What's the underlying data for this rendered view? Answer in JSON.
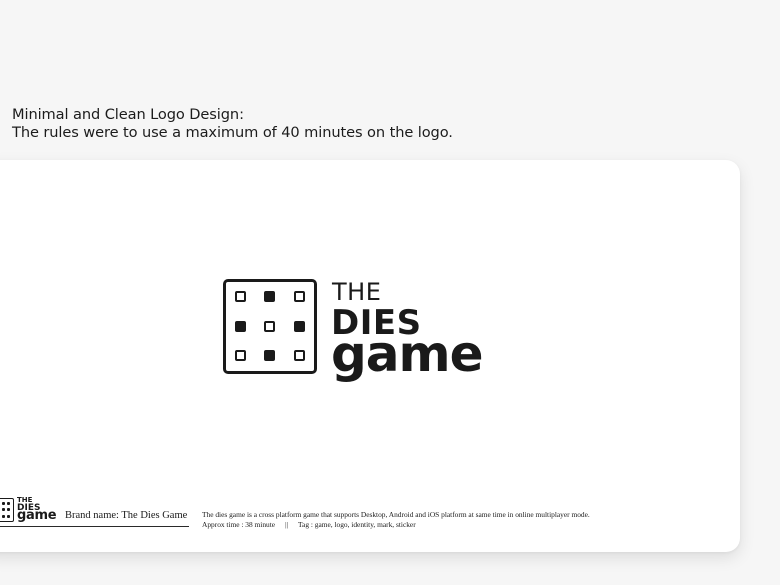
{
  "intro": {
    "line1": "Minimal and Clean Logo Design:",
    "line2": "The rules were to use a maximum of 40 minutes on the logo."
  },
  "logo": {
    "the": "THE",
    "dies": "DIES",
    "game": "game",
    "pips": [
      "hollow",
      "filled",
      "hollow",
      "filled",
      "hollow",
      "filled",
      "hollow",
      "filled",
      "hollow"
    ]
  },
  "footer": {
    "mini_logo": {
      "the": "THE",
      "dies": "DIES",
      "game": "game"
    },
    "brand_name": "Brand name: The Dies Game",
    "description": "The dies game is a cross platform game that supports Desktop, Android and iOS platform at same time in online multiplayer mode.",
    "approx_time": "Approx time : 38 minute",
    "separator": "||",
    "tags": "Tag :  game, logo, identity, mark, sticker"
  }
}
